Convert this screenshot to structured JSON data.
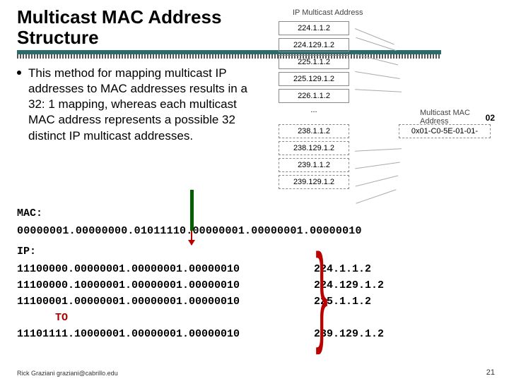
{
  "title": "Multicast MAC Address Structure",
  "bullet": "This method for mapping multicast IP addresses to MAC addresses results in a 32: 1 mapping, whereas each multicast MAC address represents a possible 32 distinct IP multicast addresses.",
  "diagram": {
    "ip_label": "IP Multicast Address",
    "mac_label": "Multicast MAC\nAddress",
    "ips_top": [
      "224.1.1.2",
      "224.129.1.2",
      "225.1.1.2",
      "225.129.1.2",
      "226.1.1.2"
    ],
    "dots": "...",
    "ips_bottom": [
      "238.1.1.2",
      "238.129.1.2",
      "239.1.1.2",
      "239.129.1.2"
    ],
    "mac": "0x01-C0-5E-01-01-",
    "overlay": "02"
  },
  "mac_section": {
    "label": "MAC:",
    "value": "00000001.00000000.01011110.00000001.00000001.00000010"
  },
  "ip_section": {
    "label": "IP:",
    "rows": [
      {
        "bin": "11100000.00000001.00000001.00000010",
        "dot": "224.1.1.2"
      },
      {
        "bin": "11100000.10000001.00000001.00000010",
        "dot": "224.129.1.2"
      },
      {
        "bin": "11100001.00000001.00000001.00000010",
        "dot": "225.1.1.2"
      }
    ],
    "to": "TO",
    "last": {
      "bin": "11101111.10000001.00000001.00000010",
      "dot": "239.129.1.2"
    }
  },
  "footer": {
    "left": "Rick Graziani  graziani@cabrillo.edu",
    "right": "21"
  }
}
